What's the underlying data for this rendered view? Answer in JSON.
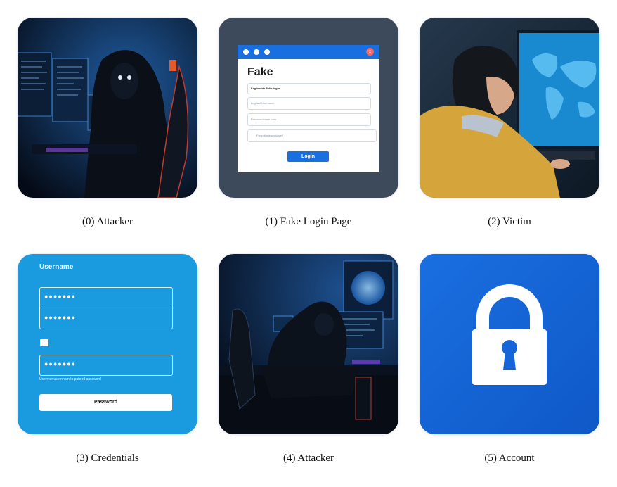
{
  "panels": [
    {
      "caption": "(0) Attacker"
    },
    {
      "caption": "(1) Fake Login Page",
      "window": {
        "title": "Fake",
        "field1": "Legitmatte Fake login",
        "field2": "Legitabl Username",
        "field3": "Passwordexam.com",
        "field4": "Forgotthsleacwdage?",
        "button": "Login",
        "close": "x"
      }
    },
    {
      "caption": "(2) Victim"
    },
    {
      "caption": "(3) Credentials",
      "form": {
        "label": "Username",
        "dots1": "●●●●●●●",
        "dots2": "●●●●●●●",
        "dots3": "●●●●●●●",
        "hint": "Usermer usernnam to pateed password",
        "button": "Password"
      }
    },
    {
      "caption": "(4) Attacker"
    },
    {
      "caption": "(5) Account"
    }
  ],
  "colors": {
    "blue_panel": "#1a9be0",
    "lock_bg": "#1565d8",
    "fake_frame": "#3d4a5c"
  },
  "icons": [
    "hooded-attacker-icon",
    "browser-window-icon",
    "victim-person-icon",
    "credentials-form-icon",
    "hooded-attacker-icon",
    "padlock-icon"
  ]
}
